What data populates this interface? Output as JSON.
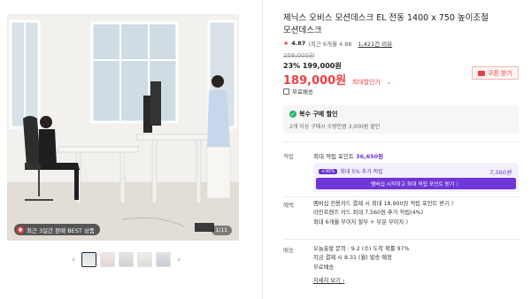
{
  "gallery": {
    "badge": "최근 3일간 판매 BEST 상품",
    "counter": "1/11",
    "thumbnail_count": 5
  },
  "product": {
    "title": "제닉스 오비스 모션데스크 EL 전동 1400 x 750 높이조절 모션데스크",
    "rating_score": "4.87",
    "rating_detail": "(최근 6개월 4.88",
    "review_count": "1,421건 리뷰",
    "original_price": "259,000원",
    "discount_line": "23% 199,000원",
    "final_price": "189,000원",
    "final_price_label": "최대할인가",
    "coupon_button": "쿠폰 받기",
    "shipping": "무료배송"
  },
  "multi_purchase": {
    "title": "복수 구매 할인",
    "desc": "2개 이상 구매시 수량만큼 3,000원 할인"
  },
  "points": {
    "label": "적립",
    "row_prefix": "최대 적립 포인트",
    "row_value": "36,650원",
    "extra_tag": "+30%",
    "extra_label": "최대 5% 추가 적립",
    "extra_value": "7,560원",
    "cta": "멤버십 시작하고 최대 적립 포인트 받기 〉"
  },
  "benefits": {
    "label": "혜택",
    "items": [
      "멤버십 전용카드 결제 시 최대 18,900원 적립 포인트 받기 〉",
      "라인프렌즈 카드 최대 7,560원 추가 적립(4%)",
      "최대 6개월 무이자 할부 + 부분 무이자 〉"
    ]
  },
  "delivery": {
    "label": "배송",
    "items": [
      "오늘출발 문의 · 9.2 (수) 도착 확률 97%",
      "지금 결제 시 8.31 (월) 발송 예정",
      "무료배송"
    ],
    "more": "자세히 보기"
  },
  "colors": {
    "accent_red": "#ef3e42",
    "point_purple": "#6f36d8"
  }
}
